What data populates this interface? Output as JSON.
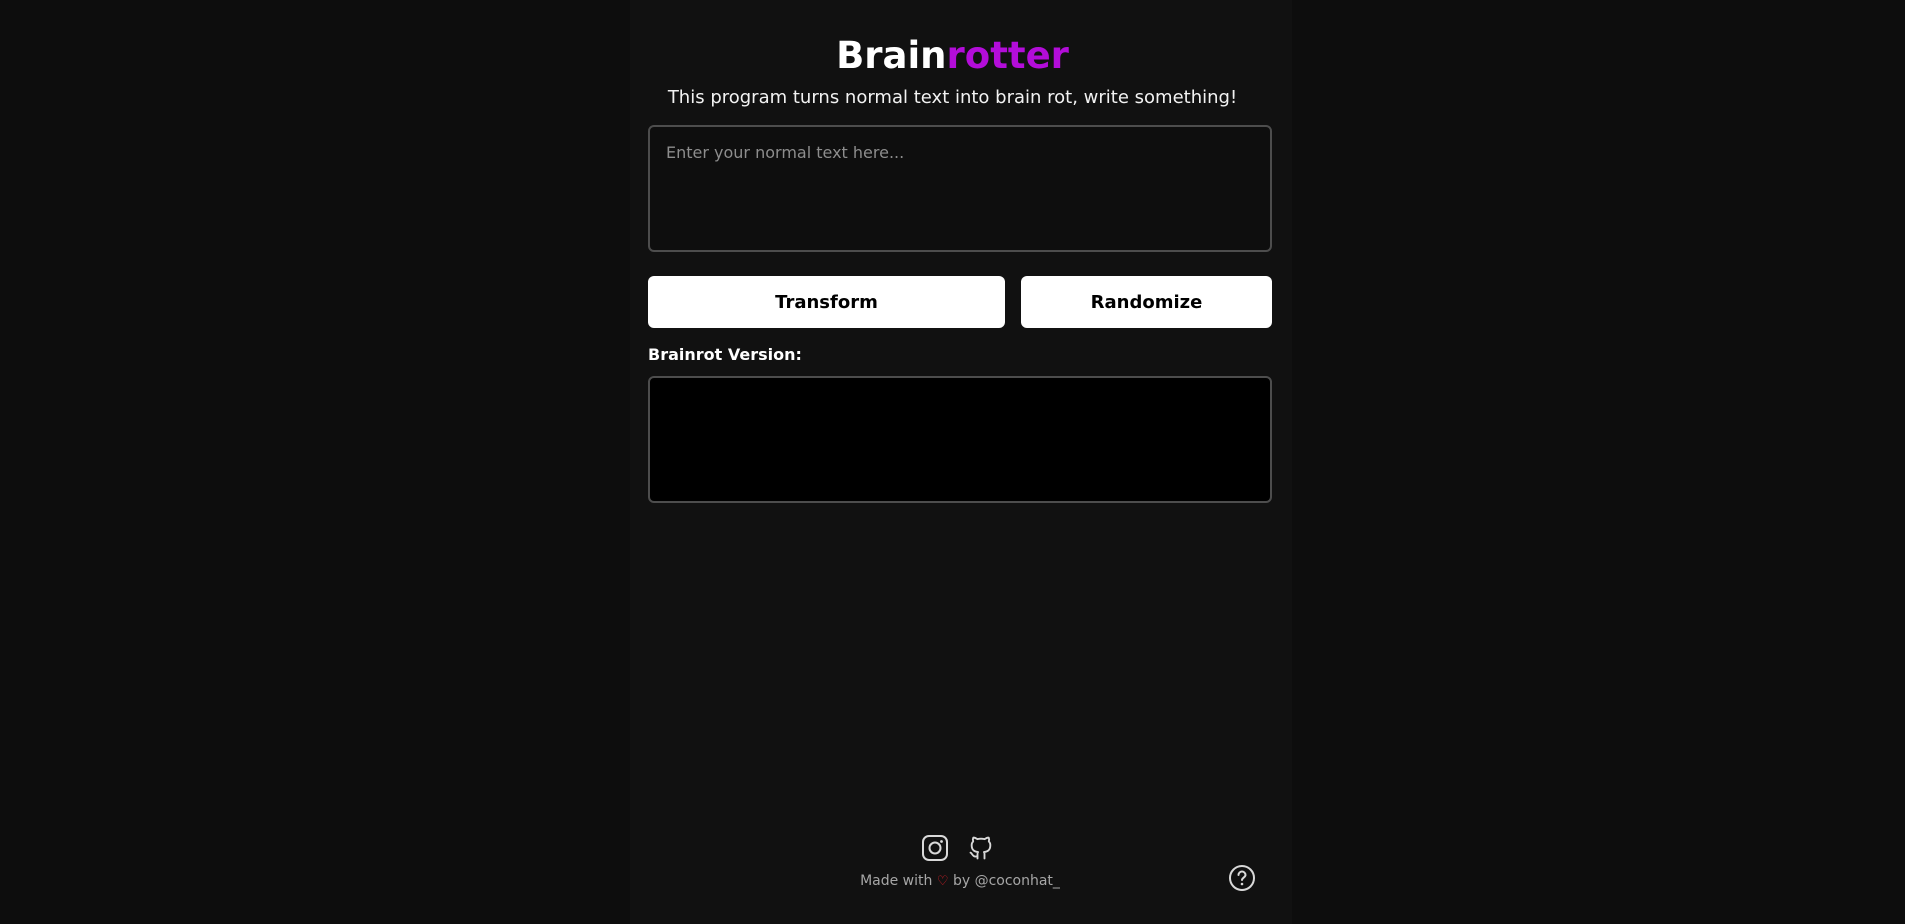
{
  "header": {
    "title_part1": "Brain",
    "title_part2": "rotter",
    "subtitle": "This program turns normal text into brain rot, write something!"
  },
  "input": {
    "placeholder": "Enter your normal text here...",
    "value": ""
  },
  "actions": {
    "transform_label": "Transform",
    "randomize_label": "Randomize"
  },
  "output": {
    "label": "Brainrot Version:",
    "value": ""
  },
  "footer": {
    "social_icons": [
      "instagram-icon",
      "github-icon"
    ],
    "made_with": "Made with",
    "heart": "♡",
    "by_text": "by @coconhat_",
    "help_icon": "question-circle-icon"
  },
  "colors": {
    "background": "#0d0d0d",
    "accent": "#b30dd9",
    "heart": "#e0202a"
  }
}
